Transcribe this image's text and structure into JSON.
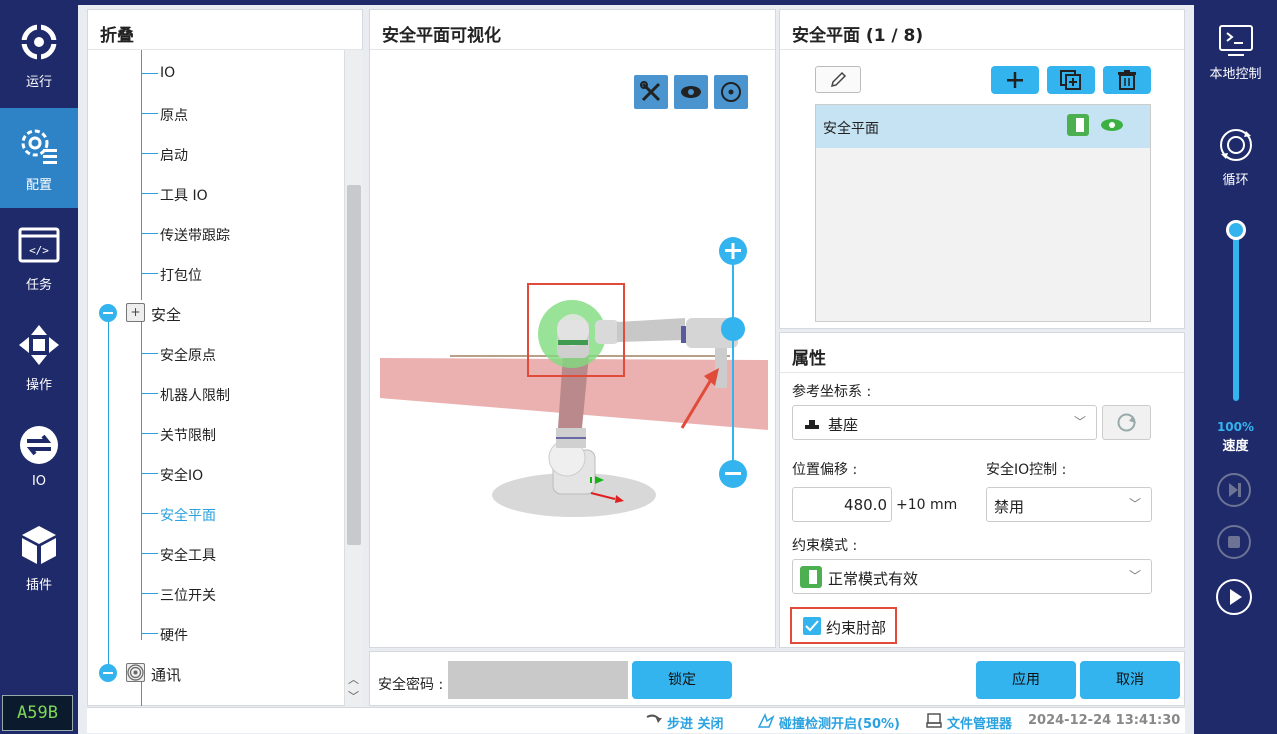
{
  "nav": {
    "items": [
      {
        "label": "运行",
        "icon": "run-icon"
      },
      {
        "label": "配置",
        "icon": "config-icon",
        "active": true
      },
      {
        "label": "任务",
        "icon": "task-icon"
      },
      {
        "label": "操作",
        "icon": "move-icon"
      },
      {
        "label": "IO",
        "icon": "io-icon"
      },
      {
        "label": "插件",
        "icon": "plugin-icon"
      }
    ],
    "badge": "A59B"
  },
  "tree": {
    "title": "折叠",
    "items": [
      "IO",
      "原点",
      "启动",
      "工具 IO",
      "传送带跟踪",
      "打包位"
    ],
    "safety_group": "安全",
    "safety_items": [
      "安全原点",
      "机器人限制",
      "关节限制",
      "安全IO",
      "安全平面",
      "安全工具",
      "三位开关",
      "硬件"
    ],
    "comm_group": "通讯"
  },
  "viz": {
    "title": "安全平面可视化",
    "password_label": "安全密码 :",
    "password_value": "",
    "lock_label": "锁定"
  },
  "planes": {
    "title": "安全平面 (1 / 8)",
    "list": [
      {
        "name": "安全平面"
      }
    ]
  },
  "props": {
    "title": "属性",
    "ref_label": "参考坐标系 :",
    "ref_value": "基座",
    "offset_label": "位置偏移 :",
    "offset_value": "480.0",
    "offset_unit": "+10 mm",
    "io_label": "安全IO控制 :",
    "io_value": "禁用",
    "mode_label": "约束模式 :",
    "mode_value": "正常模式有效",
    "elbow_label": "约束肘部",
    "elbow_checked": true,
    "apply_label": "应用",
    "cancel_label": "取消"
  },
  "right": {
    "local_label": "本地控制",
    "loop_label": "循环",
    "speed_value": "100%",
    "speed_fraction": 1.0,
    "speed_label": "速度"
  },
  "status": {
    "step": "步进 关闭",
    "collision": "碰撞检测开启(50%)",
    "files": "文件管理器",
    "time": "2024-12-24 13:41:30"
  },
  "colors": {
    "accent": "#33b4ee",
    "nav_bg": "#1f2a6b",
    "nav_active": "#2e83c7",
    "green": "#4caf50"
  }
}
